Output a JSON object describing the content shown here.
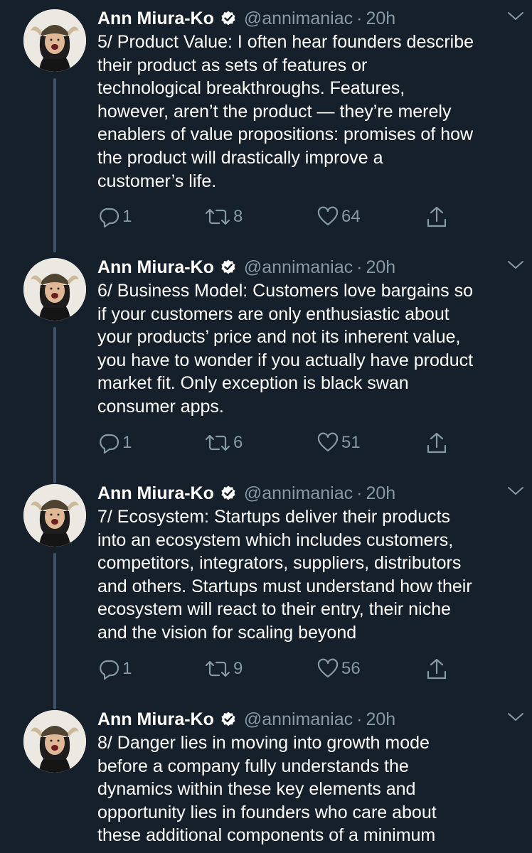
{
  "tweets": [
    {
      "display_name": "Ann Miura-Ko",
      "handle": "@annimaniac",
      "separator": "·",
      "time": "20h",
      "text": "5/ Product Value: I often hear founders describe\ntheir product as sets of features or\ntechnological breakthroughs. Features,\nhowever, aren’t the product — they’re merely\nenablers of value propositions: promises of how\nthe product will drastically improve a\ncustomer’s life.",
      "replies": "1",
      "retweets": "8",
      "likes": "64"
    },
    {
      "display_name": "Ann Miura-Ko",
      "handle": "@annimaniac",
      "separator": "·",
      "time": "20h",
      "text": "6/ Business Model: Customers love bargains so\nif your customers are only enthusiastic about\nyour products’ price and not its inherent value,\nyou have to wonder if you actually have product\nmarket fit. Only exception is black swan\nconsumer apps.",
      "replies": "1",
      "retweets": "6",
      "likes": "51"
    },
    {
      "display_name": "Ann Miura-Ko",
      "handle": "@annimaniac",
      "separator": "·",
      "time": "20h",
      "text": "7/ Ecosystem: Startups deliver their products\ninto an ecosystem which includes customers,\ncompetitors, integrators, suppliers, distributors\nand others. Startups must understand how their\necosystem will react to their entry, their niche\nand the vision for scaling beyond",
      "replies": "1",
      "retweets": "9",
      "likes": "56"
    },
    {
      "display_name": "Ann Miura-Ko",
      "handle": "@annimaniac",
      "separator": "·",
      "time": "20h",
      "text": "8/ Danger lies in moving into growth mode\nbefore a company fully understands the\ndynamics within these key elements and\nopportunity lies in founders who care about\nthese additional components of a minimum",
      "replies": "",
      "retweets": "",
      "likes": ""
    }
  ],
  "icons": {
    "verified": "verified-badge-icon",
    "caret": "chevron-down-icon",
    "reply": "reply-icon",
    "retweet": "retweet-icon",
    "like": "heart-icon",
    "share": "share-icon"
  },
  "colors": {
    "background": "#15202b",
    "primary_text": "#ffffff",
    "secondary_text": "#8899a6",
    "thread_line": "#3d5466"
  }
}
